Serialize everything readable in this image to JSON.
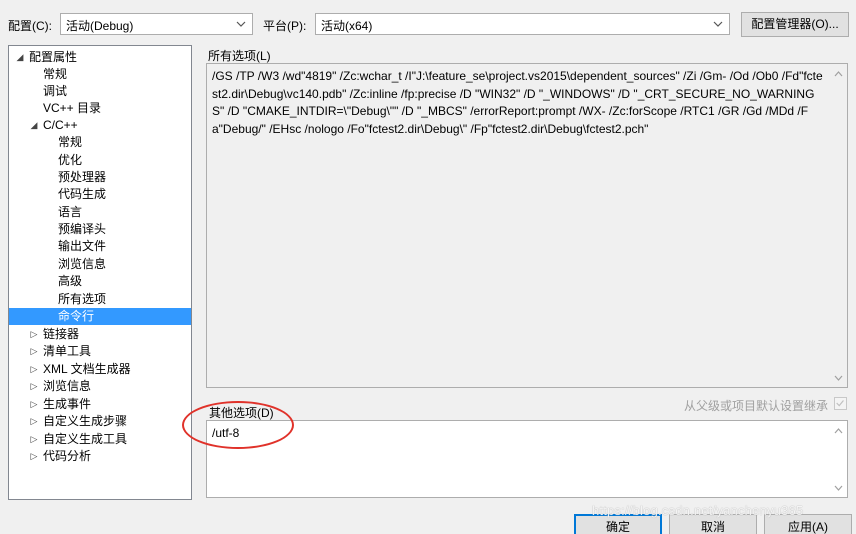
{
  "toolbar": {
    "config_label": "配置(C):",
    "config_value": "活动(Debug)",
    "platform_label": "平台(P):",
    "platform_value": "活动(x64)",
    "config_manager_button": "配置管理器(O)..."
  },
  "tree": {
    "root": "配置属性",
    "general": "常规",
    "debugging": "调试",
    "vc_dirs": "VC++ 目录",
    "cpp": "C/C++",
    "cpp_general": "常规",
    "cpp_optimization": "优化",
    "cpp_preprocessor": "预处理器",
    "cpp_codegen": "代码生成",
    "cpp_language": "语言",
    "cpp_pch": "预编译头",
    "cpp_output": "输出文件",
    "cpp_browse": "浏览信息",
    "cpp_advanced": "高级",
    "cpp_all_options": "所有选项",
    "cpp_cmdline": "命令行",
    "linker": "链接器",
    "manifest_tool": "清单工具",
    "xml_doc": "XML 文档生成器",
    "browse_info": "浏览信息",
    "build_events": "生成事件",
    "custom_build_step": "自定义生成步骤",
    "custom_build_tool": "自定义生成工具",
    "code_analysis": "代码分析"
  },
  "main": {
    "all_options_label": "所有选项(L)",
    "all_options_text": "/GS /TP /W3 /wd\"4819\" /Zc:wchar_t /I\"J:\\feature_se\\project.vs2015\\dependent_sources\" /Zi /Gm- /Od /Ob0 /Fd\"fctest2.dir\\Debug\\vc140.pdb\" /Zc:inline /fp:precise /D \"WIN32\" /D \"_WINDOWS\" /D \"_CRT_SECURE_NO_WARNINGS\" /D \"CMAKE_INTDIR=\\\"Debug\\\"\" /D \"_MBCS\" /errorReport:prompt /WX- /Zc:forScope /RTC1 /GR /Gd /MDd /Fa\"Debug/\" /EHsc /nologo /Fo\"fctest2.dir\\Debug\\\" /Fp\"fctest2.dir\\Debug\\fctest2.pch\"",
    "other_options_label": "其他选项(D)",
    "other_options_value": "/utf-8",
    "inherit_label": "从父级或项目默认设置继承"
  },
  "footer": {
    "ok": "确定",
    "cancel": "取消",
    "apply": "应用(A)",
    "watermark": "https://blog.csdn.net/yanchenyu365"
  },
  "colors": {
    "selection": "#3399ff",
    "highlight_circle": "#e0322a"
  }
}
